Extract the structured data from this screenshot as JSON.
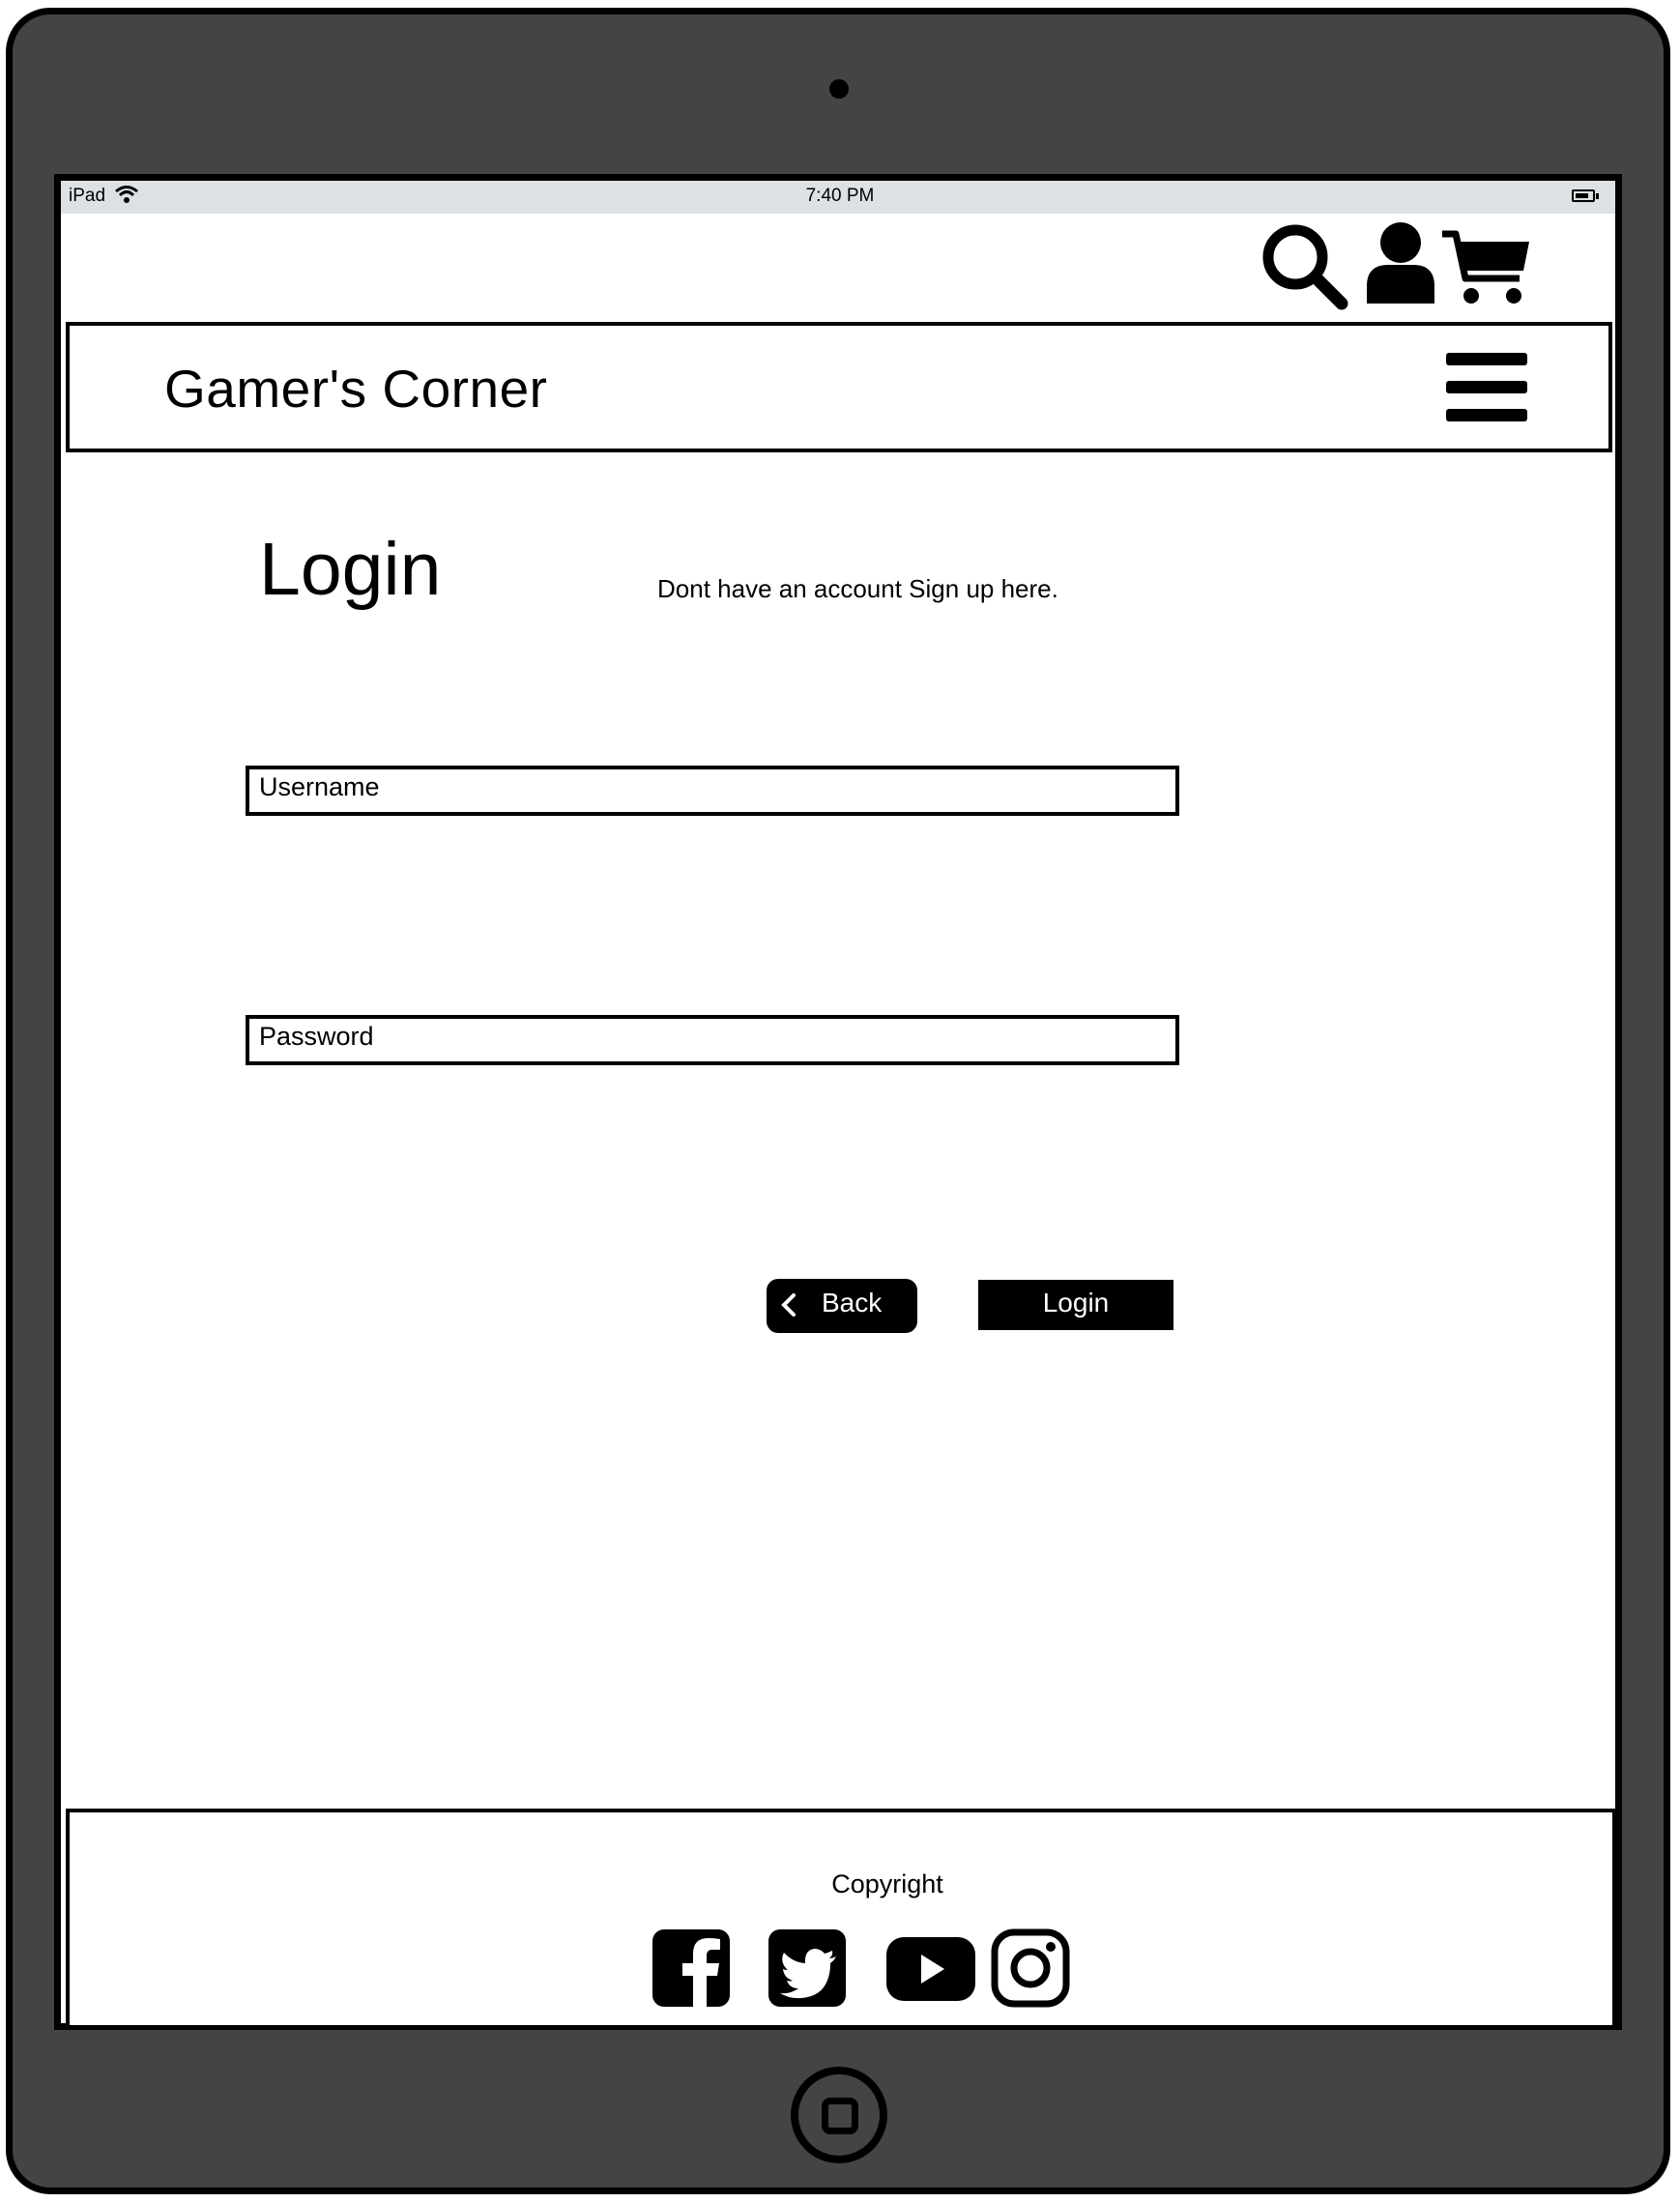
{
  "status_bar": {
    "device": "iPad",
    "time": "7:40 PM"
  },
  "header": {
    "icons": [
      "search-icon",
      "user-icon",
      "cart-icon"
    ],
    "brand": "Gamer's Corner",
    "menu_icon": "hamburger-menu-icon"
  },
  "main": {
    "title": "Login",
    "signup_text": "Dont have an account Sign up here.",
    "username_placeholder": "Username",
    "password_placeholder": "Password",
    "back_label": "Back",
    "login_label": "Login"
  },
  "footer": {
    "copyright": "Copyright",
    "social_icons": [
      "facebook-icon",
      "twitter-icon",
      "youtube-icon",
      "instagram-icon"
    ]
  },
  "colors": {
    "device_frame": "#444444",
    "status_bar": "#dde1e3",
    "ink": "#000000"
  }
}
